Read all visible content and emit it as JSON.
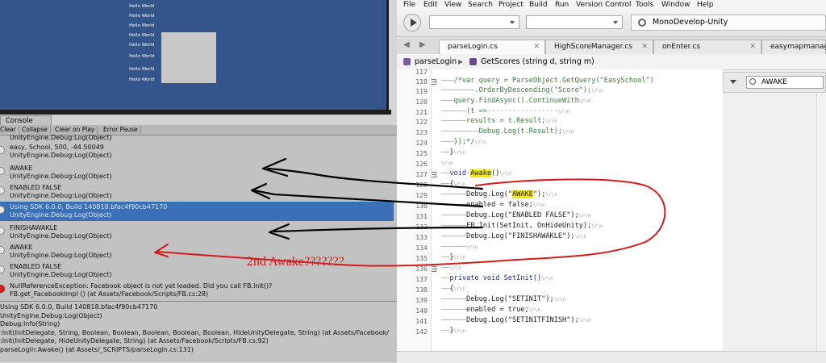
{
  "game": {
    "lines": [
      "Hello World",
      "Hello World",
      "Hello World",
      "Hello World",
      "Hello World",
      "Hello World",
      "Hello World",
      "Hello World"
    ]
  },
  "console": {
    "tab_label": "Console",
    "toolbar": [
      "Clear",
      "Collapse",
      "Clear on Play",
      "Error Pause"
    ],
    "top_partial": "UnityEngine.Debug:Log(Object)",
    "entries": [
      {
        "line1": "easy, School, 500, -44.50049",
        "line2": "UnityEngine.Debug:Log(Object)"
      },
      {
        "line1": "AWAKE",
        "line2": "UnityEngine.Debug:Log(Object)"
      },
      {
        "line1": "ENABLED FALSE",
        "line2": "UnityEngine.Debug:Log(Object)"
      },
      {
        "line1": "Using SDK 6.0.0, Build 140818.bfac4f90cb47170",
        "line2": "UnityEngine.Debug:Log(Object)"
      },
      {
        "line1": "FINISHAWAKLE",
        "line2": "UnityEngine.Debug:Log(Object)"
      },
      {
        "line1": "AWAKE",
        "line2": "UnityEngine.Debug:Log(Object)"
      },
      {
        "line1": "ENABLED FALSE",
        "line2": "UnityEngine.Debug:Log(Object)"
      },
      {
        "line1": "NullReferenceException: Facebook object is not yet loaded.  Did you call FB.Init()?",
        "line2": "FB.get_FacebookImpl () (at Assets/Facebook/Scripts/FB.cs:28)"
      }
    ],
    "detail": [
      "Using SDK 6.0.0, Build 140818.bfac4f90cb47170",
      "UnityEngine.Debug:Log(Object)",
      "Debug:Info(String)",
      ":Init(InitDelegate, String, Boolean, Boolean, Boolean, Boolean, Boolean, HideUnityDelegate, String) (at Assets/Facebook/",
      ":Init(InitDelegate, HideUnityDelegate, String) (at Assets/Facebook/Scripts/FB.cs:92)",
      "parseLogin:Awake() (at Assets/_SCRIPTS/parseLogin.cs:131)"
    ]
  },
  "ide": {
    "menus": [
      "File",
      "Edit",
      "View",
      "Search",
      "Project",
      "Build",
      "Run",
      "Version Control",
      "Tools",
      "Window",
      "Help"
    ],
    "status_text": "MonoDevelop-Unity",
    "tabs": [
      "parseLogin.cs",
      "HighScoreManager.cs",
      "onEnter.cs",
      "easymapmanager.cs"
    ],
    "breadcrumb": {
      "class_name": "parseLogin",
      "method": "GetScores (string d, string m)"
    },
    "search_value": "AWAKE",
    "line_numbers": [
      "117",
      "118",
      "119",
      "120",
      "121",
      "122",
      "123",
      "124",
      "125",
      "126",
      "127",
      "128",
      "129",
      "130",
      "131",
      "132",
      "133",
      "134",
      "135",
      "136",
      "137",
      "138",
      "139",
      "140",
      "141",
      "142"
    ],
    "code": {
      "l118": "/*var query = ParseObject.GetQuery(\"EasySchool\")",
      "l119": ".OrderByDescending(\"Score\");",
      "l120": "query.FindAsync().ContinueWith",
      "l121": "(t =>",
      "l122": "results = t.Result;",
      "l123": "Debug.Log(t.Result);",
      "l124": "});*/",
      "l125": "}",
      "l127_kw": "void",
      "l127_name": "Awake",
      "l127_rest": "()",
      "l128": "{",
      "l129_pre": "Debug.Log(\"",
      "l129_hl": "AWAKE",
      "l129_post": "\");",
      "l130": "enabled = false;",
      "l131": "Debug.Log(\"ENABLED FALSE\");",
      "l132": "FB.Init(SetInit, OnHideUnity);",
      "l133": "Debug.Log(\"FINISHAWAKLE\");",
      "l135": "}",
      "l137": "private void SetInit()",
      "l138": "{",
      "l139": "Debug.Log(\"SETINIT\");",
      "l140": "enabled = true;",
      "l141": "Debug.Log(\"SETINITFINISH\");",
      "l142": "}",
      "eol": "\\r\\n"
    }
  },
  "annotation": {
    "text": "2nd Awake???????",
    "color": "#d01c1c"
  }
}
